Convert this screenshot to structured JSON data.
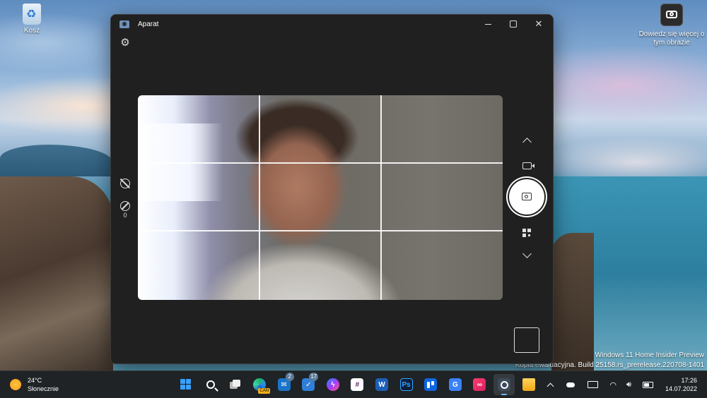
{
  "desktop": {
    "recycle_bin_label": "Kosz",
    "learn_more_label": "Dowiedz się więcej o tym obrazie",
    "watermark": {
      "line1": "Windows 11 Home Insider Preview",
      "line2": "Kopia ewaluacyjna. Build 25158.rs_prerelease.220708-1401"
    }
  },
  "camera_window": {
    "title": "Aparat",
    "exposure_value": "0",
    "icons": {
      "settings": "gear-icon",
      "timer": "timer-off-icon",
      "exposure": "exposure-icon",
      "video": "video-camera-icon",
      "photo": "camera-icon",
      "qr": "qr-code-icon"
    }
  },
  "taskbar": {
    "weather": {
      "temp": "24°C",
      "condition": "Słonecznie"
    },
    "apps": [
      {
        "name": "start",
        "badge": ""
      },
      {
        "name": "search",
        "badge": ""
      },
      {
        "name": "task-view",
        "badge": ""
      },
      {
        "name": "edge-canary",
        "badge": "CAN"
      },
      {
        "name": "mail",
        "badge": "2"
      },
      {
        "name": "microsoft-todo",
        "badge": "17"
      },
      {
        "name": "messenger",
        "badge": ""
      },
      {
        "name": "slack",
        "badge": ""
      },
      {
        "name": "word",
        "badge": ""
      },
      {
        "name": "photoshop",
        "badge": ""
      },
      {
        "name": "trello",
        "badge": ""
      },
      {
        "name": "translator",
        "badge": ""
      },
      {
        "name": "creative-cloud",
        "badge": ""
      },
      {
        "name": "camera",
        "badge": ""
      },
      {
        "name": "file-explorer",
        "badge": ""
      }
    ],
    "clock": {
      "time": "17:26",
      "date": "14.07.2022"
    }
  },
  "colors": {
    "window_bg": "#202020",
    "taskbar_bg": "#1f2326",
    "accent": "#6ab4ff"
  }
}
